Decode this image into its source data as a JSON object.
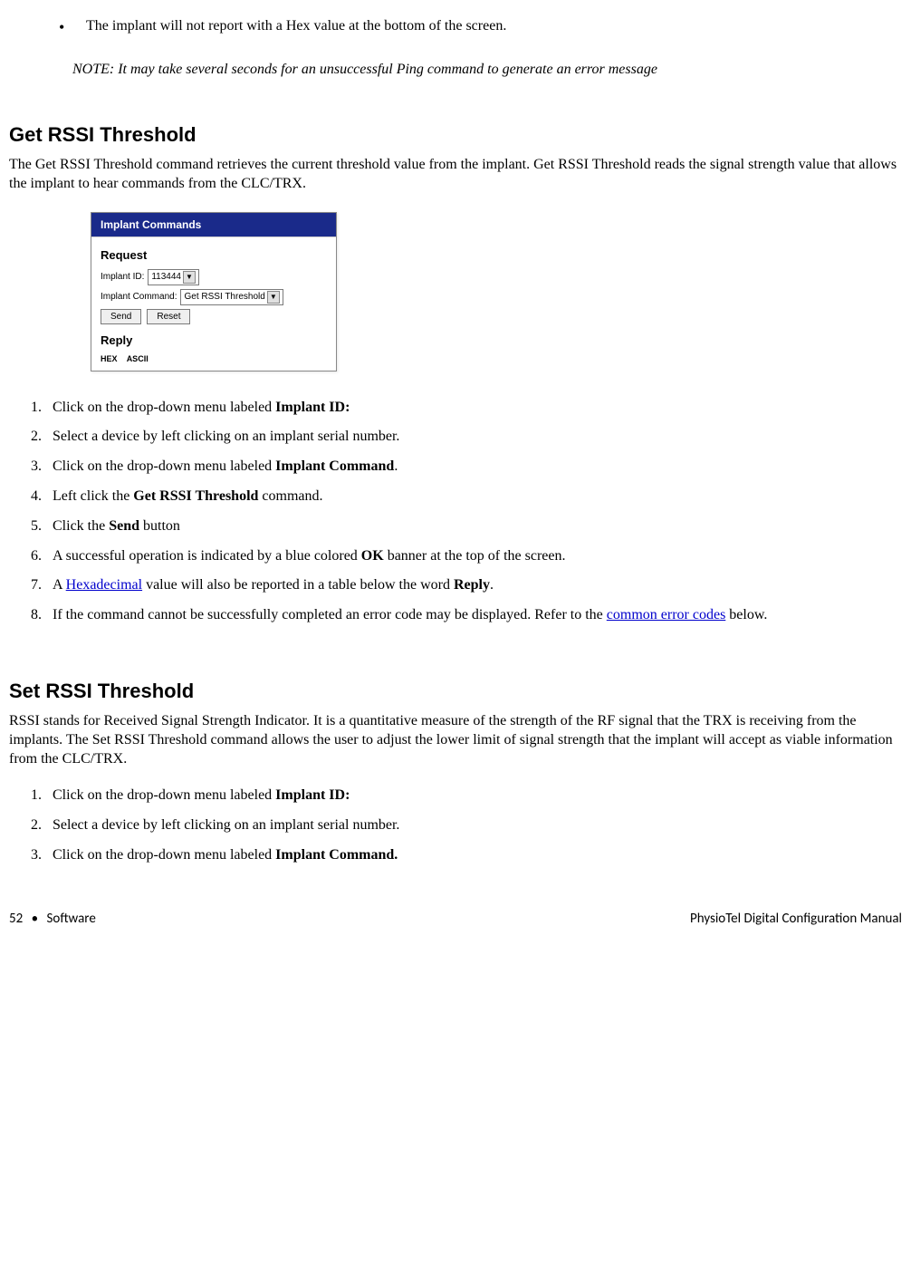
{
  "bullet": {
    "text": "The implant will not report with a Hex value at the bottom of the screen."
  },
  "note": "NOTE: It may take several seconds for an unsuccessful Ping command to generate an error message",
  "section1": {
    "heading": "Get RSSI Threshold",
    "para": "The Get RSSI Threshold command retrieves the current threshold value from the implant. Get RSSI Threshold reads the signal strength value that allows the implant to hear commands from the CLC/TRX."
  },
  "screenshot": {
    "title": "Implant Commands",
    "request_label": "Request",
    "implant_id_label": "Implant ID:",
    "implant_id_value": "113444",
    "implant_command_label": "Implant Command:",
    "implant_command_value": "Get RSSI Threshold",
    "send": "Send",
    "reset": "Reset",
    "reply_label": "Reply",
    "hex": "HEX",
    "ascii": "ASCII"
  },
  "steps1": {
    "s1a": "Click on the drop-down menu labeled ",
    "s1b": "Implant ID:",
    "s2": "Select a device by left clicking on an implant serial number.",
    "s3a": "Click on the drop-down menu labeled ",
    "s3b": "Implant Command",
    "s3c": ".",
    "s4a": "Left click the ",
    "s4b": "Get RSSI Threshold",
    "s4c": " command.",
    "s5a": "Click the ",
    "s5b": "Send",
    "s5c": " button",
    "s6a": "A successful operation is indicated by a blue colored ",
    "s6b": "OK",
    "s6c": " banner at the top of the screen.",
    "s7a": "A ",
    "s7link": "Hexadecimal",
    "s7b": " value will also be reported in a table below the word ",
    "s7c": "Reply",
    "s7d": ".",
    "s8a": "If the command cannot be successfully completed an error code may be displayed. Refer to the ",
    "s8link": "common error codes",
    "s8b": " below."
  },
  "section2": {
    "heading": "Set RSSI Threshold",
    "para": "RSSI stands for Received Signal Strength Indicator. It is a quantitative measure of the strength of the RF signal that the TRX is receiving from the implants.  The Set RSSI Threshold command allows the user to adjust the lower limit of signal strength that the implant will accept as viable information from the CLC/TRX."
  },
  "steps2": {
    "s1a": "Click on the drop-down menu labeled ",
    "s1b": "Implant ID:",
    "s2": "Select a device by left clicking on an implant serial number.",
    "s3a": "Click on the drop-down menu labeled ",
    "s3b": "Implant Command."
  },
  "footer": {
    "page": "52",
    "bullet": "•",
    "section": "Software",
    "manual": "PhysioTel Digital Configuration Manual"
  }
}
